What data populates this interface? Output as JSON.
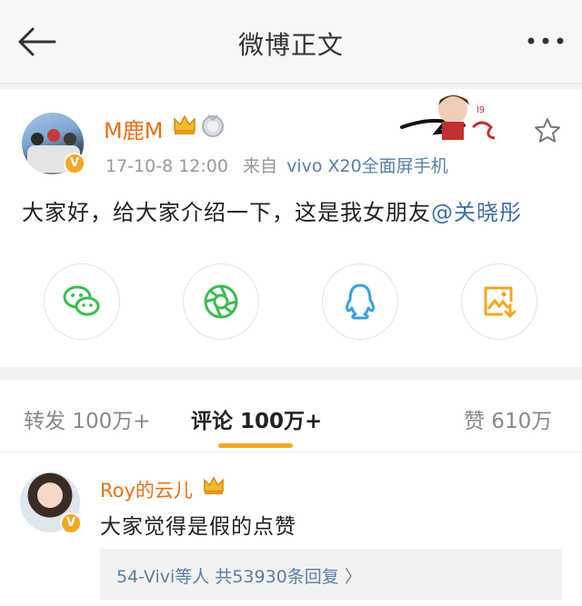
{
  "nav": {
    "title": "微博正文",
    "back_icon": "back-arrow-icon",
    "more_icon": "more-dots-icon"
  },
  "post": {
    "username": "M鹿M",
    "verified_badge": "V",
    "time": "17-10-8 12:00",
    "source_prefix": "来自",
    "source": "vivo X20全面屏手机",
    "text": "大家好，给大家介绍一下，这是我女朋友",
    "mention": "@关晓彤"
  },
  "share": [
    {
      "icon": "wechat-icon",
      "color": "#3dbb52"
    },
    {
      "icon": "moments-icon",
      "color": "#3dbb52"
    },
    {
      "icon": "qq-icon",
      "color": "#3aa0e0"
    },
    {
      "icon": "save-image-icon",
      "color": "#f5a623"
    }
  ],
  "tabs": {
    "repost": "转发 100万+",
    "comment": "评论 100万+",
    "like": "赞 610万"
  },
  "comment": {
    "username": "Roy的云儿",
    "verified_badge": "V",
    "text": "大家觉得是假的点赞",
    "replies": "54-Vivi等人  共53930条回复 〉"
  },
  "colors": {
    "accent": "#f5a623",
    "username": "#e8701a",
    "link": "#3f6da8"
  }
}
